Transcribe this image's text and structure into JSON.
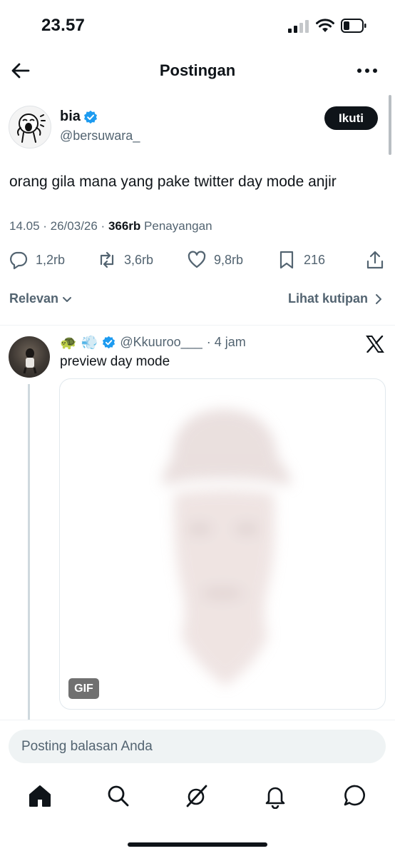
{
  "status_bar": {
    "time": "23.57"
  },
  "header": {
    "title": "Postingan"
  },
  "post": {
    "author_name": "bia",
    "author_handle": "@bersuwara_",
    "follow_label": "Ikuti",
    "text": "orang gila mana yang pake twitter day mode anjir",
    "timestamp": "14.05 · 26/03/26 · ",
    "views_count": "366rb",
    "views_label": "Penayangan",
    "actions": {
      "replies": "1,2rb",
      "reposts": "3,6rb",
      "likes": "9,8rb",
      "bookmarks": "216"
    }
  },
  "sort": {
    "label": "Relevan",
    "quotes_link": "Lihat kutipan"
  },
  "reply": {
    "emojis": "🐢 💨",
    "handle": "@Kkuuroo___",
    "time": "· 4 jam",
    "text": "preview day mode",
    "media_badge": "GIF"
  },
  "composer": {
    "placeholder": "Posting balasan Anda"
  },
  "nav": {
    "tabs": [
      "home-icon",
      "search-icon",
      "grok-icon",
      "notifications-icon",
      "messages-icon"
    ]
  },
  "colors": {
    "accent": "#1d9bf0",
    "text": "#0f1419",
    "muted": "#536471"
  }
}
